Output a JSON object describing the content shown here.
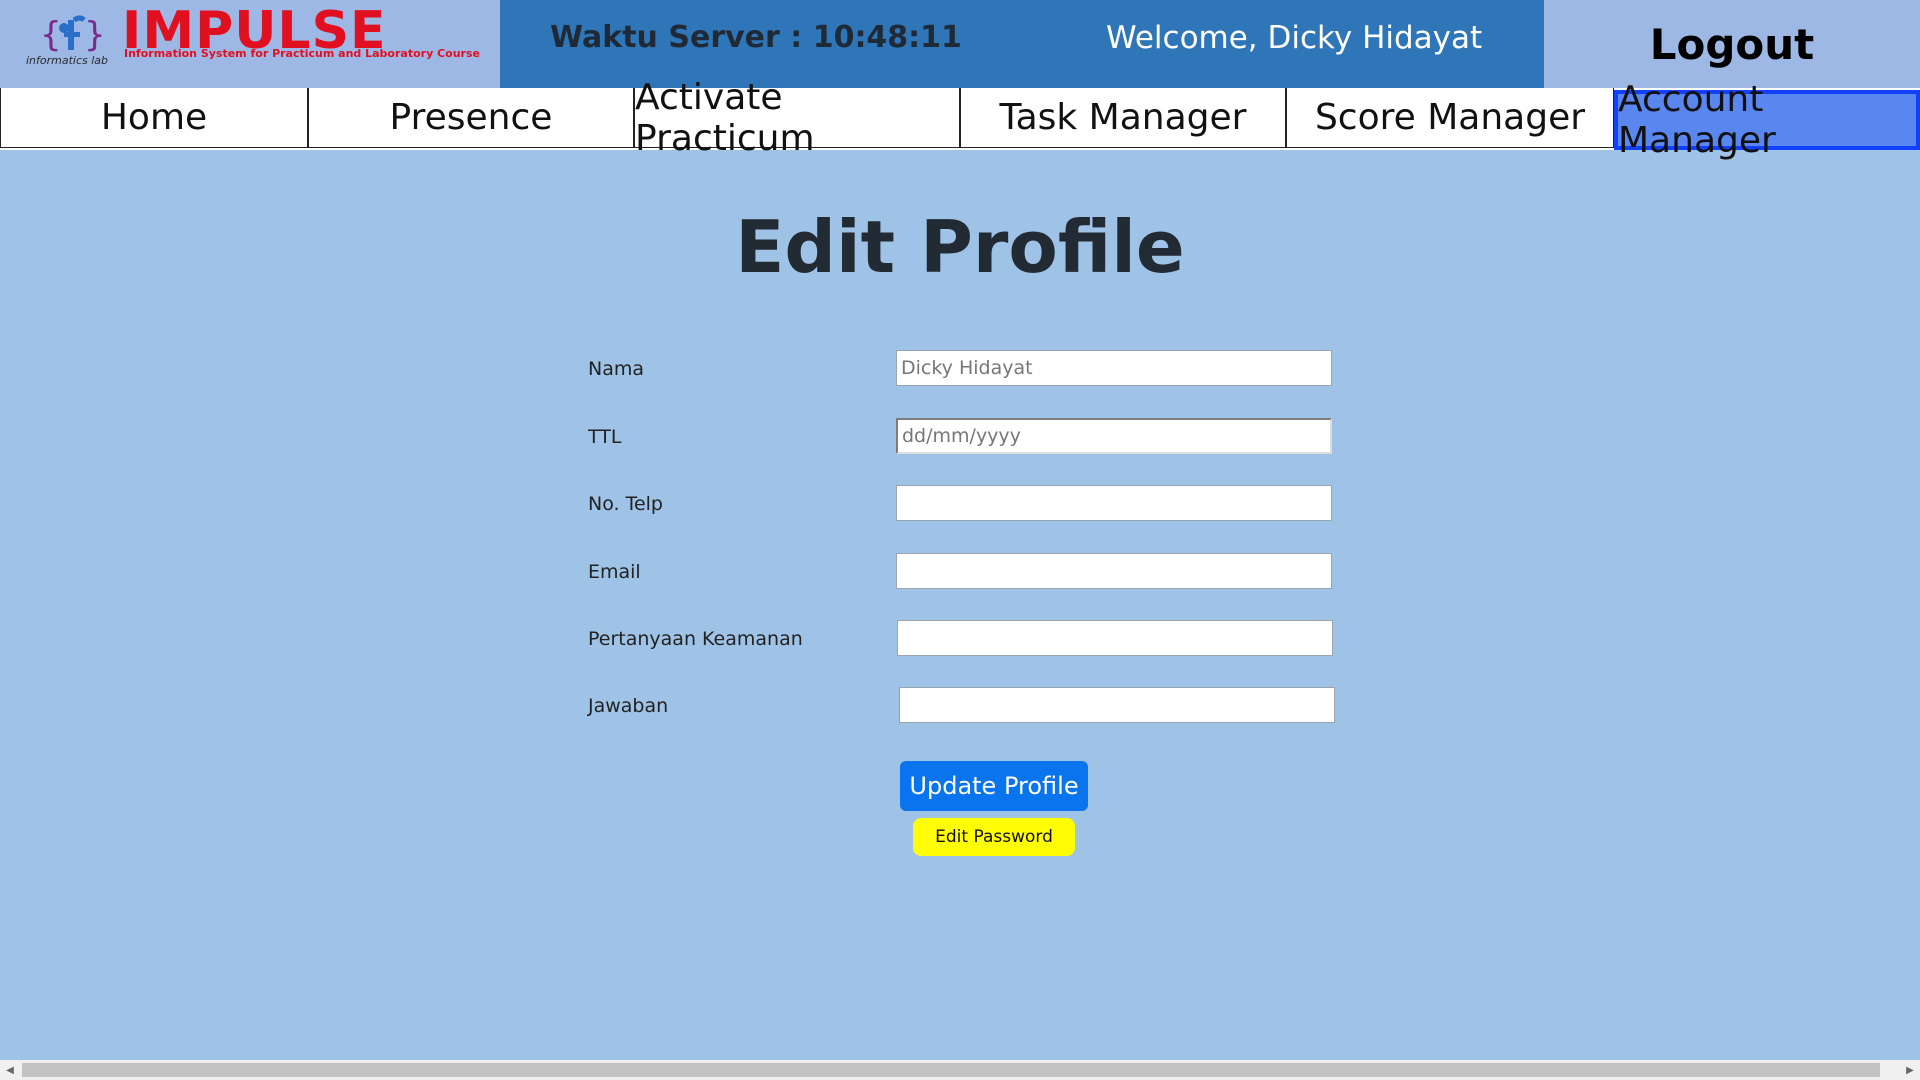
{
  "header": {
    "logo_name": "IMPULSE",
    "logo_subtitle": "Information System for Practicum and Laboratory Course",
    "logo_lab": "informatics lab",
    "server_time": "Waktu Server : 10:48:11",
    "welcome": "Welcome, Dicky Hidayat",
    "logout_label": "Logout",
    "brand_color": "#e11020"
  },
  "nav": {
    "items": [
      {
        "label": "Home"
      },
      {
        "label": "Presence"
      },
      {
        "label": "Activate Practicum"
      },
      {
        "label": "Task Manager"
      },
      {
        "label": "Score Manager"
      },
      {
        "label": "Account Manager",
        "active": true
      }
    ]
  },
  "page": {
    "title": "Edit Profile"
  },
  "form": {
    "nama": {
      "label": "Nama",
      "value": "",
      "placeholder": "Dicky Hidayat"
    },
    "ttl": {
      "label": "TTL",
      "value": "",
      "placeholder": "dd/mm/yyyy"
    },
    "telp": {
      "label": "No. Telp",
      "value": "",
      "placeholder": ""
    },
    "email": {
      "label": "Email",
      "value": "",
      "placeholder": ""
    },
    "pertanyaan": {
      "label": "Pertanyaan Keamanan",
      "value": "",
      "placeholder": ""
    },
    "jawaban": {
      "label": "Jawaban",
      "value": "",
      "placeholder": ""
    },
    "update_label": "Update Profile",
    "edit_password_label": "Edit Password"
  },
  "colors": {
    "background": "#9fc3e6",
    "header_blue": "#2f76b8",
    "update_button": "#0a74ee",
    "edit_password_button": "#fffc06",
    "active_nav": "#5a86f0"
  }
}
